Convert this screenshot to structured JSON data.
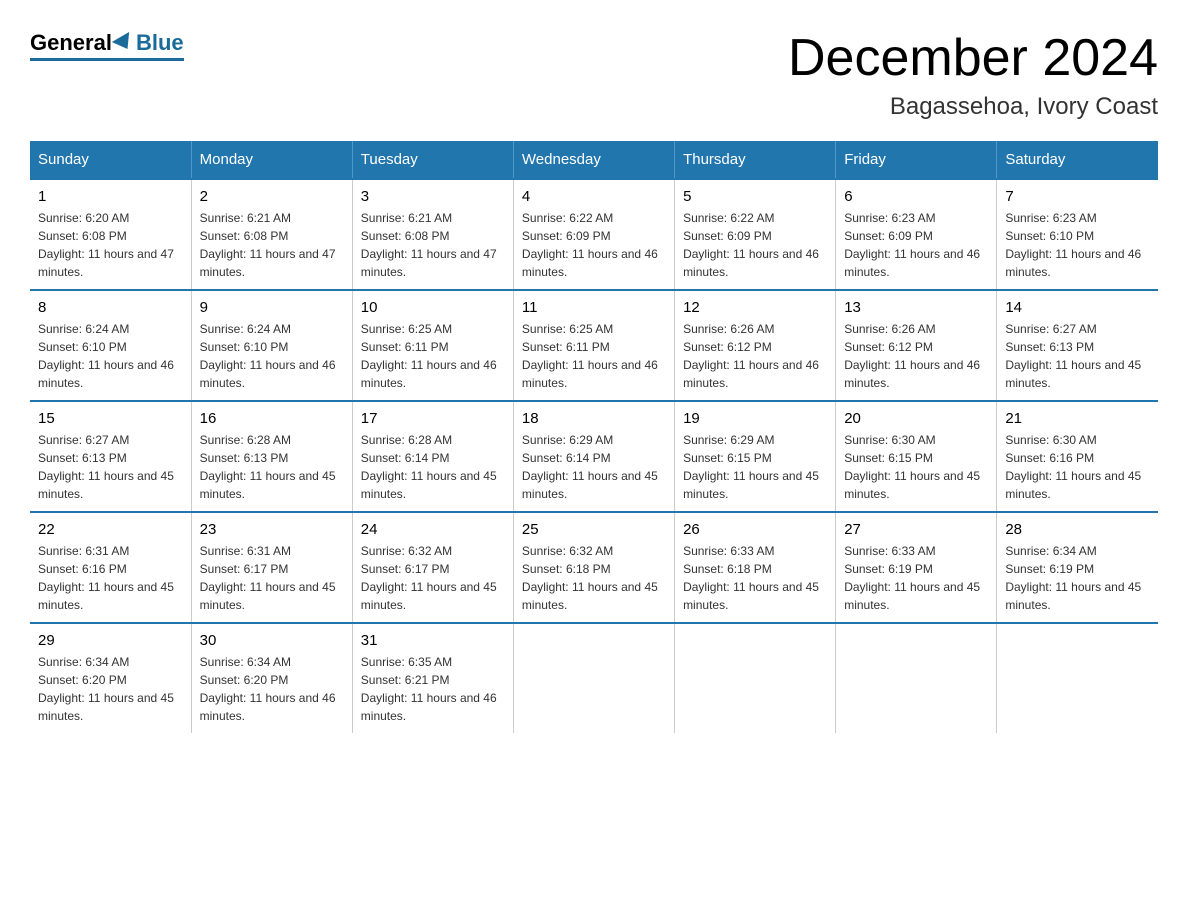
{
  "logo": {
    "general": "General",
    "blue": "Blue"
  },
  "header": {
    "month": "December 2024",
    "location": "Bagassehoa, Ivory Coast"
  },
  "days_of_week": [
    "Sunday",
    "Monday",
    "Tuesday",
    "Wednesday",
    "Thursday",
    "Friday",
    "Saturday"
  ],
  "weeks": [
    [
      {
        "day": "1",
        "sunrise": "6:20 AM",
        "sunset": "6:08 PM",
        "daylight": "11 hours and 47 minutes."
      },
      {
        "day": "2",
        "sunrise": "6:21 AM",
        "sunset": "6:08 PM",
        "daylight": "11 hours and 47 minutes."
      },
      {
        "day": "3",
        "sunrise": "6:21 AM",
        "sunset": "6:08 PM",
        "daylight": "11 hours and 47 minutes."
      },
      {
        "day": "4",
        "sunrise": "6:22 AM",
        "sunset": "6:09 PM",
        "daylight": "11 hours and 46 minutes."
      },
      {
        "day": "5",
        "sunrise": "6:22 AM",
        "sunset": "6:09 PM",
        "daylight": "11 hours and 46 minutes."
      },
      {
        "day": "6",
        "sunrise": "6:23 AM",
        "sunset": "6:09 PM",
        "daylight": "11 hours and 46 minutes."
      },
      {
        "day": "7",
        "sunrise": "6:23 AM",
        "sunset": "6:10 PM",
        "daylight": "11 hours and 46 minutes."
      }
    ],
    [
      {
        "day": "8",
        "sunrise": "6:24 AM",
        "sunset": "6:10 PM",
        "daylight": "11 hours and 46 minutes."
      },
      {
        "day": "9",
        "sunrise": "6:24 AM",
        "sunset": "6:10 PM",
        "daylight": "11 hours and 46 minutes."
      },
      {
        "day": "10",
        "sunrise": "6:25 AM",
        "sunset": "6:11 PM",
        "daylight": "11 hours and 46 minutes."
      },
      {
        "day": "11",
        "sunrise": "6:25 AM",
        "sunset": "6:11 PM",
        "daylight": "11 hours and 46 minutes."
      },
      {
        "day": "12",
        "sunrise": "6:26 AM",
        "sunset": "6:12 PM",
        "daylight": "11 hours and 46 minutes."
      },
      {
        "day": "13",
        "sunrise": "6:26 AM",
        "sunset": "6:12 PM",
        "daylight": "11 hours and 46 minutes."
      },
      {
        "day": "14",
        "sunrise": "6:27 AM",
        "sunset": "6:13 PM",
        "daylight": "11 hours and 45 minutes."
      }
    ],
    [
      {
        "day": "15",
        "sunrise": "6:27 AM",
        "sunset": "6:13 PM",
        "daylight": "11 hours and 45 minutes."
      },
      {
        "day": "16",
        "sunrise": "6:28 AM",
        "sunset": "6:13 PM",
        "daylight": "11 hours and 45 minutes."
      },
      {
        "day": "17",
        "sunrise": "6:28 AM",
        "sunset": "6:14 PM",
        "daylight": "11 hours and 45 minutes."
      },
      {
        "day": "18",
        "sunrise": "6:29 AM",
        "sunset": "6:14 PM",
        "daylight": "11 hours and 45 minutes."
      },
      {
        "day": "19",
        "sunrise": "6:29 AM",
        "sunset": "6:15 PM",
        "daylight": "11 hours and 45 minutes."
      },
      {
        "day": "20",
        "sunrise": "6:30 AM",
        "sunset": "6:15 PM",
        "daylight": "11 hours and 45 minutes."
      },
      {
        "day": "21",
        "sunrise": "6:30 AM",
        "sunset": "6:16 PM",
        "daylight": "11 hours and 45 minutes."
      }
    ],
    [
      {
        "day": "22",
        "sunrise": "6:31 AM",
        "sunset": "6:16 PM",
        "daylight": "11 hours and 45 minutes."
      },
      {
        "day": "23",
        "sunrise": "6:31 AM",
        "sunset": "6:17 PM",
        "daylight": "11 hours and 45 minutes."
      },
      {
        "day": "24",
        "sunrise": "6:32 AM",
        "sunset": "6:17 PM",
        "daylight": "11 hours and 45 minutes."
      },
      {
        "day": "25",
        "sunrise": "6:32 AM",
        "sunset": "6:18 PM",
        "daylight": "11 hours and 45 minutes."
      },
      {
        "day": "26",
        "sunrise": "6:33 AM",
        "sunset": "6:18 PM",
        "daylight": "11 hours and 45 minutes."
      },
      {
        "day": "27",
        "sunrise": "6:33 AM",
        "sunset": "6:19 PM",
        "daylight": "11 hours and 45 minutes."
      },
      {
        "day": "28",
        "sunrise": "6:34 AM",
        "sunset": "6:19 PM",
        "daylight": "11 hours and 45 minutes."
      }
    ],
    [
      {
        "day": "29",
        "sunrise": "6:34 AM",
        "sunset": "6:20 PM",
        "daylight": "11 hours and 45 minutes."
      },
      {
        "day": "30",
        "sunrise": "6:34 AM",
        "sunset": "6:20 PM",
        "daylight": "11 hours and 46 minutes."
      },
      {
        "day": "31",
        "sunrise": "6:35 AM",
        "sunset": "6:21 PM",
        "daylight": "11 hours and 46 minutes."
      },
      null,
      null,
      null,
      null
    ]
  ]
}
